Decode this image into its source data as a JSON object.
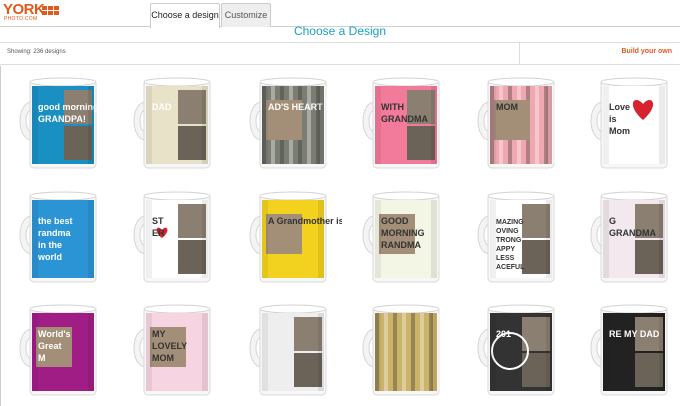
{
  "header": {
    "logo_text": "YORK",
    "logo_sub": "PHOTO.COM",
    "tabs": [
      {
        "label": "Choose a design",
        "active": true
      },
      {
        "label": "Customize",
        "active": false
      }
    ]
  },
  "page_title": "Choose a Design",
  "info_bar": {
    "showing": "Showing: 236 designs",
    "build_own": "Build your own"
  },
  "colors": {
    "brand": "#e05a1b",
    "title": "#1aa0c4"
  },
  "mugs": [
    {
      "name": "good-morning-grandpa",
      "texts": [
        "good morning",
        "GRANDPA!"
      ],
      "bg": "#1a8fc2"
    },
    {
      "name": "monogram-dad",
      "texts": [
        "DAD"
      ],
      "bg": "#e8e2c8"
    },
    {
      "name": "dads-heart",
      "texts": [
        "AD'S HEART"
      ],
      "bg": "#7a7d72"
    },
    {
      "name": "with-grandma",
      "texts": [
        "WITH",
        "GRANDMA"
      ],
      "bg": "#f27a9a"
    },
    {
      "name": "mom-stripes",
      "texts": [
        "MOM"
      ],
      "bg": "#f0a8b0"
    },
    {
      "name": "love-is-mom",
      "texts": [
        "Love",
        "is",
        "Mom"
      ],
      "bg": "#ffffff"
    },
    {
      "name": "best-grandma-world",
      "texts": [
        "the best",
        "randma",
        "in the",
        "world"
      ],
      "bg": "#2b94d4"
    },
    {
      "name": "best-father",
      "texts": [
        "ST",
        "ER"
      ],
      "bg": "#ffffff"
    },
    {
      "name": "grandmother-gift",
      "texts": [
        "A Grandmother is a gift"
      ],
      "bg": "#f2d21e"
    },
    {
      "name": "good-morning-grandma",
      "texts": [
        "GOOD",
        "MORNING",
        "RANDMA"
      ],
      "bg": "#f3f5e5"
    },
    {
      "name": "amazing-loving-strong",
      "texts": [
        "MAZING",
        "OVING",
        "TRONG",
        "APPY",
        "LESS",
        "ACEFUL"
      ],
      "bg": "#ffffff"
    },
    {
      "name": "grandma-pink",
      "texts": [
        "G",
        "GRANDMA"
      ],
      "bg": "#f2e8ee"
    },
    {
      "name": "worlds-greatest-mom",
      "texts": [
        "World's",
        "Great",
        "M"
      ],
      "bg": "#a11d86"
    },
    {
      "name": "my-lovely-mom",
      "texts": [
        "MY",
        "LOVELY",
        "MOM"
      ],
      "bg": "#f7d4e2"
    },
    {
      "name": "chevron-photos",
      "texts": [],
      "bg": "#eeeeee"
    },
    {
      "name": "gold-stripes-photo",
      "texts": [],
      "bg": "#cbb368"
    },
    {
      "name": "chalkboard-201",
      "texts": [
        "201"
      ],
      "bg": "#333333"
    },
    {
      "name": "my-dad-collage",
      "texts": [
        "RE MY DAD"
      ],
      "bg": "#222222"
    }
  ]
}
